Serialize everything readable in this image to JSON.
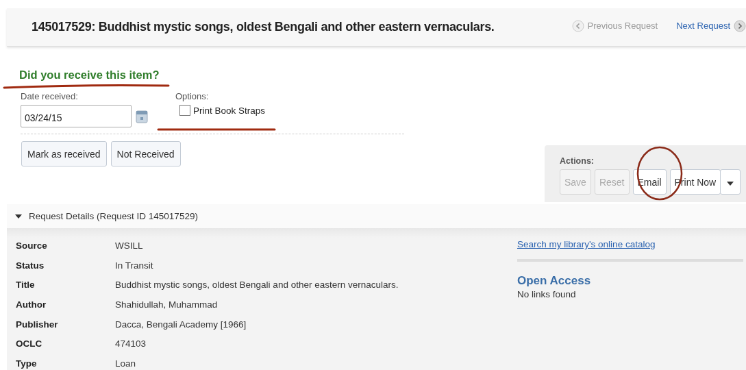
{
  "header": {
    "title": "145017529: Buddhist mystic songs, oldest Bengali and other eastern vernaculars.",
    "previous": "Previous Request",
    "next": "Next Request"
  },
  "receive": {
    "heading": "Did you receive this item?",
    "date_label": "Date received:",
    "date_value": "03/24/15",
    "options_label": "Options:",
    "option": {
      "label": "Print Book Straps",
      "checked": false
    },
    "buttons": [
      "Mark as received",
      "Not Received"
    ]
  },
  "actions": {
    "label": "Actions:",
    "buttons": [
      {
        "label": "Save",
        "disabled": true
      },
      {
        "label": "Reset",
        "disabled": true
      },
      {
        "label": "Email",
        "disabled": false
      },
      {
        "label": "Print Now",
        "disabled": false
      }
    ]
  },
  "details": {
    "heading": "Request Details (Request ID 145017529)",
    "expanded": true,
    "rows": [
      {
        "label": "Source",
        "value": "WSILL"
      },
      {
        "label": "Status",
        "value": "In Transit"
      },
      {
        "label": "Title",
        "value": "Buddhist mystic songs, oldest Bengali and other eastern vernaculars."
      },
      {
        "label": "Author",
        "value": "Shahidullah, Muhammad"
      },
      {
        "label": "Publisher",
        "value": "Dacca, Bengali Academy [1966]"
      },
      {
        "label": "OCLC",
        "value": "474103"
      },
      {
        "label": "Type",
        "value": "Loan"
      }
    ]
  },
  "links": {
    "catalog": "Search my library's online catalog",
    "open_access_heading": "Open Access",
    "open_access_text": "No links found"
  }
}
